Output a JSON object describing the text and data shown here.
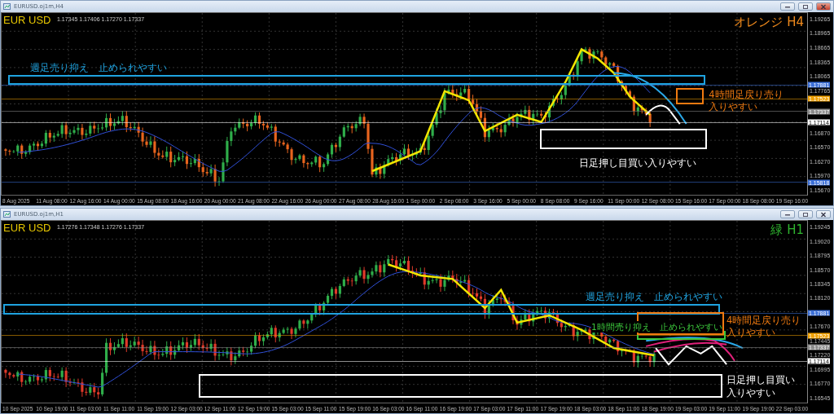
{
  "windows": [
    {
      "title": "EURUSD.oj1m,H4",
      "active": true,
      "symbol": "EUR USD",
      "ohlc": "1.17345 1.17406 1.17270 1.17337",
      "timeframe": {
        "text": "オレンジ H4",
        "color": "#f08a1c"
      },
      "price_ticks": [
        "1.19265",
        "1.18965",
        "1.18665",
        "1.18365",
        "1.18065",
        "1.17765",
        "1.16870",
        "1.16570",
        "1.16270",
        "1.15970",
        "1.15670"
      ],
      "levels": [
        {
          "label": "1.17881",
          "color": "#3b6fd8"
        },
        {
          "label": "1.17523",
          "color": "#f0a000"
        },
        {
          "label": "1.17337",
          "color": "#8a8a8a"
        },
        {
          "label": "1.17114",
          "color": "#ffffff"
        },
        {
          "label": "1.15818",
          "color": "#3b6fd8"
        }
      ],
      "time_labels": [
        "8 Aug 2025",
        "11 Aug 08:00",
        "12 Aug 16:00",
        "14 Aug 00:00",
        "15 Aug 08:00",
        "18 Aug 16:00",
        "20 Aug 00:00",
        "21 Aug 08:00",
        "22 Aug 16:00",
        "26 Aug 00:00",
        "27 Aug 08:00",
        "28 Aug 16:00",
        "1 Sep 00:00",
        "2 Sep 08:00",
        "3 Sep 16:00",
        "5 Sep 00:00",
        "8 Sep 08:00",
        "9 Sep 16:00",
        "11 Sep 00:00",
        "12 Sep 08:00",
        "15 Sep 16:00",
        "17 Sep 00:00",
        "18 Sep 08:00",
        "19 Sep 16:00"
      ],
      "zones": [
        {
          "color": "#1fa3e0",
          "lines": [
            "週足売り抑え　止められやすい"
          ]
        },
        {
          "color": "#f07a10",
          "lines": [
            "4時間足戻り売り",
            "入りやすい"
          ]
        },
        {
          "color": "#ffffff",
          "lines": [
            "日足押し目買い入りやすい"
          ]
        }
      ]
    },
    {
      "title": "EURUSD.oj1m,H1",
      "active": false,
      "symbol": "EUR USD",
      "ohlc": "1.17276 1.17348 1.17276 1.17337",
      "timeframe": {
        "text": "緑 H1",
        "color": "#2fb52f"
      },
      "price_ticks": [
        "1.19245",
        "1.19020",
        "1.18795",
        "1.18570",
        "1.18345",
        "1.18120",
        "1.17670",
        "1.17445",
        "1.17220",
        "1.16995",
        "1.16770",
        "1.16545"
      ],
      "levels": [
        {
          "label": "1.17881",
          "color": "#3b6fd8"
        },
        {
          "label": "1.17523",
          "color": "#f0a000"
        },
        {
          "label": "1.17337",
          "color": "#8a8a8a"
        },
        {
          "label": "1.17114",
          "color": "#ffffff"
        }
      ],
      "time_labels": [
        "10 Sep 2025",
        "10 Sep 19:00",
        "11 Sep 03:00",
        "11 Sep 11:00",
        "11 Sep 19:00",
        "12 Sep 03:00",
        "12 Sep 11:00",
        "12 Sep 19:00",
        "15 Sep 03:00",
        "15 Sep 11:00",
        "15 Sep 19:00",
        "16 Sep 03:00",
        "16 Sep 11:00",
        "16 Sep 19:00",
        "17 Sep 03:00",
        "17 Sep 11:00",
        "17 Sep 19:00",
        "18 Sep 03:00",
        "18 Sep 11:00",
        "18 Sep 19:00",
        "19 Sep 03:00",
        "19 Sep 11:00",
        "19 Sep 19:00",
        "22 Sep 03:00"
      ],
      "zones": [
        {
          "color": "#1fa3e0",
          "lines": [
            "週足売り抑え　止められやすい"
          ]
        },
        {
          "color": "#3cc83c",
          "lines": [
            "1時間売り抑え　止められやすい"
          ]
        },
        {
          "color": "#f07a10",
          "lines": [
            "4時間足戻り売り",
            "入りやすい"
          ]
        },
        {
          "color": "#ffffff",
          "lines": [
            "日足押し目買い",
            "入りやすい"
          ]
        }
      ]
    }
  ]
}
